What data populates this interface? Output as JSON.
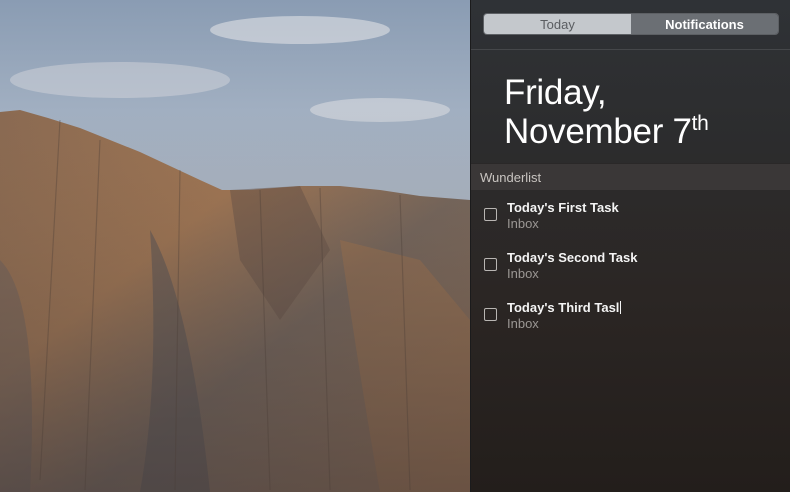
{
  "segmented_control": {
    "today_label": "Today",
    "notifications_label": "Notifications",
    "selected": "Today"
  },
  "date": {
    "line1": "Friday,",
    "line2_main": "November 7",
    "line2_suffix": "th"
  },
  "widget": {
    "title": "Wunderlist",
    "tasks": [
      {
        "title": "Today's First Task",
        "list": "Inbox",
        "checked": false
      },
      {
        "title": "Today's Second Task",
        "list": "Inbox",
        "checked": false
      },
      {
        "title": "Today's Third Tasl",
        "list": "Inbox",
        "checked": false
      }
    ]
  },
  "colors": {
    "panel_background": "#2c2c2d",
    "selected_segment": "#c4c8cc",
    "unselected_segment": "#6b6f74"
  }
}
